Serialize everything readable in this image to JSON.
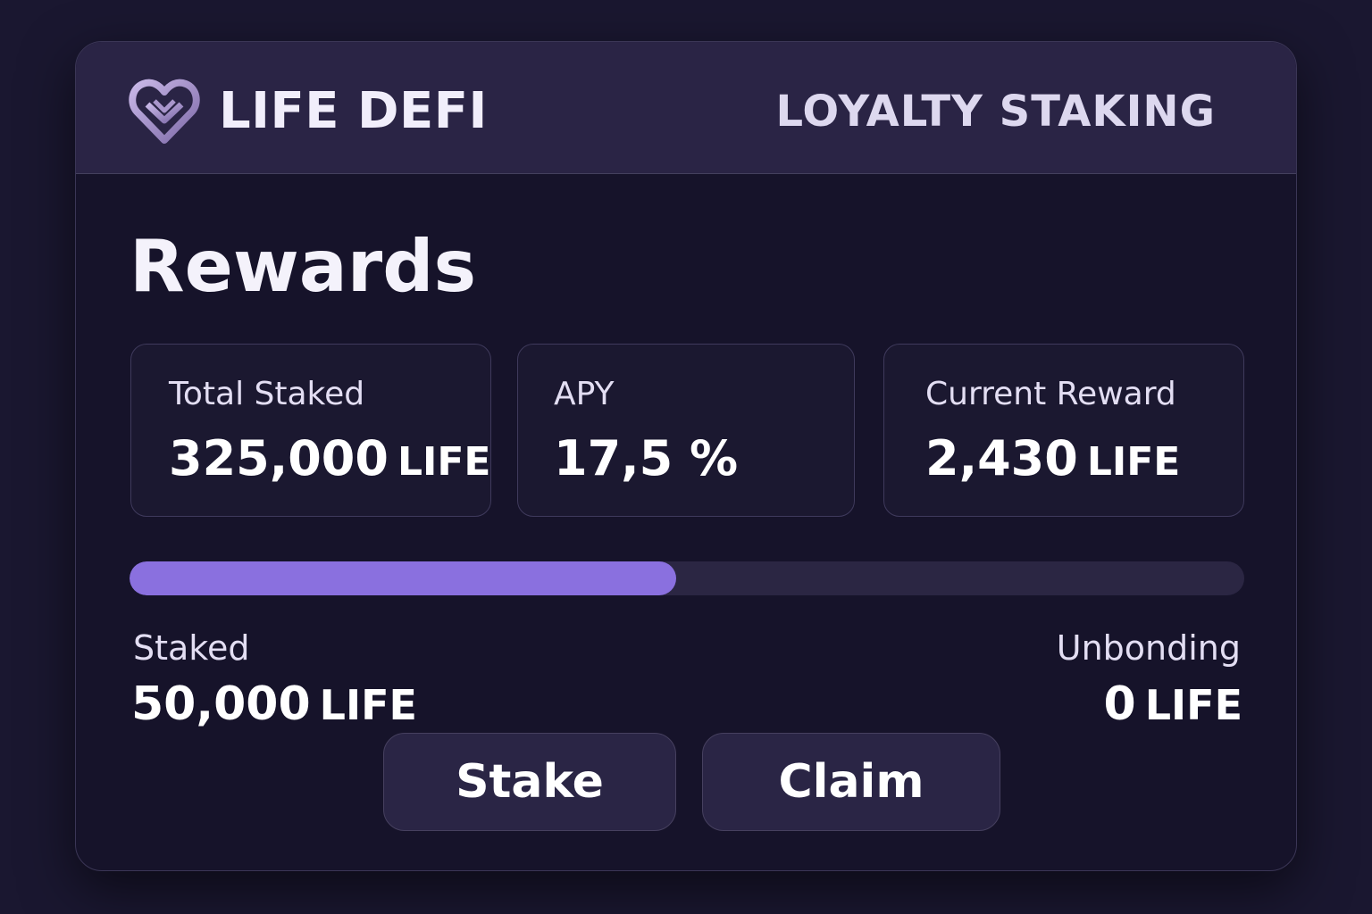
{
  "header": {
    "brand": "LIFE DEFI",
    "title": "LOYALTY STAKING",
    "logo_icon": "heart-logo-icon"
  },
  "page": {
    "title": "Rewards"
  },
  "stats": [
    {
      "label": "Total Staked",
      "value": "325,000",
      "unit": "LIFE"
    },
    {
      "label": "APY",
      "value": "17,5 %",
      "unit": ""
    },
    {
      "label": "Current Reward",
      "value": "2,430",
      "unit": "LIFE"
    }
  ],
  "progress": {
    "fraction": 0.49,
    "fill_color": "#8a70df",
    "track_color": "#2b2643"
  },
  "staked": {
    "label": "Staked",
    "value": "50,000",
    "unit": "LIFE"
  },
  "unbonding": {
    "label": "Unbonding",
    "value": "0",
    "unit": "LIFE"
  },
  "actions": {
    "stake_label": "Stake",
    "claim_label": "Claim"
  },
  "colors": {
    "background": "#1a1730",
    "card": "#16132a",
    "header": "#2a2445",
    "accent": "#8a70df"
  }
}
